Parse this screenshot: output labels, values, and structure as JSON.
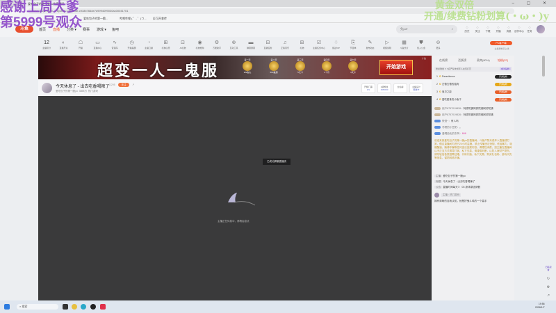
{
  "browser": {
    "tab_title": "爱吃包子的第一脆yu的直播间",
    "url": "www.douyu.com/...?dyshid=1315a0df-c918b766de7d9994099030ac00041701",
    "window_controls": "– ▢ ✕",
    "bookmarks": [
      "爱吃包子的第一脆...",
      "哔哩哔哩 ( ゜- ゜)つ...",
      "反可开拿传"
    ]
  },
  "overlay": {
    "left_line1": "感谢上周大爹",
    "left_line2": "第5999号观众",
    "right_line1": "黄金双倍",
    "right_line2": "开通/续费钻粉划算(・ω・)y"
  },
  "header": {
    "logo": "斗鱼",
    "nav": [
      "首页",
      "直播",
      "分类 ▾",
      "赛事",
      "游戏 ▾",
      "鱼吧"
    ],
    "search_placeholder": "兔yoff",
    "icons": [
      {
        "icon": "history-icon",
        "label": "历史"
      },
      {
        "icon": "heart-icon",
        "label": "关注"
      },
      {
        "icon": "download-icon",
        "label": "下载"
      },
      {
        "icon": "broadcast-icon",
        "label": "开播"
      },
      {
        "icon": "bell-icon",
        "label": "消息"
      },
      {
        "icon": "location-icon",
        "label": "创作中心"
      },
      {
        "icon": "task-icon",
        "label": "任务"
      }
    ]
  },
  "toolbar": {
    "points_value": "12",
    "items": [
      {
        "g": "",
        "l": "主播积分"
      },
      {
        "g": "◐",
        "l": "直播开关"
      },
      {
        "g": "☖",
        "l": "开播"
      },
      {
        "g": "▭",
        "l": "直播中心"
      },
      {
        "g": "∿",
        "l": "音浪码"
      },
      {
        "g": "◷",
        "l": "开播提醒"
      },
      {
        "g": "◔",
        "l": "主播口袋"
      },
      {
        "g": "⊞",
        "l": "礼物心愿"
      },
      {
        "g": "⊡",
        "l": "AI礼物"
      },
      {
        "g": "◉",
        "l": "礼物抢购"
      },
      {
        "g": "⚙",
        "l": "万能助手"
      },
      {
        "g": "⊕",
        "l": "互动工具"
      },
      {
        "g": "▬",
        "l": "弹幕屏幕"
      },
      {
        "g": "⊟",
        "l": "直播任务"
      },
      {
        "g": "♫",
        "l": "正版音乐"
      },
      {
        "g": "⊞",
        "l": "礼物"
      },
      {
        "g": "☑",
        "l": "主播任务中心"
      },
      {
        "g": "♢",
        "l": "挑战VIP"
      },
      {
        "g": "⎘",
        "l": "节目单"
      },
      {
        "g": "✎",
        "l": "发布动态"
      },
      {
        "g": "▷",
        "l": "视频剪辑"
      },
      {
        "g": "▦",
        "l": "斗鱼长片"
      },
      {
        "g": "⛊",
        "l": "加入公会"
      },
      {
        "g": "⊖",
        "l": "更多"
      }
    ],
    "pc_client": "PC客户端",
    "pc_sub": "主播录制已上线"
  },
  "banner": {
    "title": "超变一人一鬼服",
    "prizes": [
      {
        "day": "第一天",
        "label": "2W鱼丸"
      },
      {
        "day": "第二天",
        "label": "500鱼翅"
      },
      {
        "day": "第三天",
        "label": "5元卡"
      },
      {
        "day": "第四天",
        "label": "1个月"
      },
      {
        "day": "第七天",
        "label": "3天卡"
      }
    ],
    "start": "开始游戏",
    "ad": "广告"
  },
  "stream": {
    "title": "今天休息了 - 出去吃香喝辣了",
    "room_id": "41295",
    "follow": "关注",
    "share": "↗",
    "streamer": "爱吃包子的第一脆yu",
    "heat": "3858万",
    "category": "热门游戏",
    "boxes": [
      {
        "top": "开箱门票",
        "val": "0/1"
      },
      {
        "top": "1级粉丝",
        "val": "155/200"
      },
      {
        "top": "全站榜",
        "val": ""
      },
      {
        "top": "主播设计",
        "val": "赠送卡"
      }
    ]
  },
  "video": {
    "toast": "已成功屏蔽直播流",
    "status": "主播正在休息中，请稍后尝试"
  },
  "chat": {
    "tabs": [
      "在线榜",
      "活跃榜",
      "贵宾(80%)",
      "钻粉(57)"
    ],
    "fan_bar": "粉丝徽章 5",
    "fan_hint": "5名严禁未成年人充值打赏",
    "fan_btn": "成为钻粉",
    "ranking": [
      {
        "n": "1",
        "name": "Parasitemor",
        "badge": "开通钻粉",
        "c": "#222"
      },
      {
        "n": "2",
        "name": "古德古德的铭狗",
        "badge": "开通钻粉",
        "c": "#e6a81a"
      },
      {
        "n": "3",
        "name": "宝贝之影",
        "badge": "开通钻粉",
        "c": "#e8602a"
      },
      {
        "n": "4",
        "name": "爱吃甜食的小鱼干",
        "badge": "开通钻粉",
        "c": "#e8602a"
      }
    ],
    "messages": [
      {
        "u": "用户8757019826：",
        "t": "阿弥陀佛阿弥陀佛阿弥陀佛"
      },
      {
        "u": "用户8757019826：",
        "t": "阿弥陀佛阿弥陀佛阿弥陀佛"
      },
      {
        "u": "快语~：",
        "t": "有人吗"
      },
      {
        "u": "冬眠的小豆奶：",
        "t": "。"
      },
      {
        "u": "爱喝西北的东风：",
        "t": "666"
      }
    ],
    "notice": "欢迎来到爱吃包子的第一脆yu的直播间。斗鱼严禁未成年人直播或打赏，倡议直播间内进行24小时监管。禁止传播违法违规、低俗暴力、吸烟酗酒、赌博诈骗等任何违法违规内容。请理性消费，如主播在直播间以不正当方式诱导打赏、私下交易，请谨慎判断，以防人身财产损失。请勿轻信各类招聘征婚、代练代抽、私下交易、购买礼包码、游戏代充等信息，谨防网络诈骗。",
    "info": [
      {
        "k": "主播",
        "v": "爱吃包子的第一脆yu"
      },
      {
        "k": "标题",
        "v": "今天休息了 - 出去吃香喝辣了"
      },
      {
        "k": "公告",
        "v": "直播时间每天7：00-身体原因请假"
      }
    ],
    "last_user": "主播 · 热门游戏",
    "last_msg": "拥有清晰的自我认知，就是拼鬼斗鸡的一个高手"
  },
  "side_tools": [
    "扫码观看",
    "↻",
    "⚙",
    "↗"
  ],
  "taskbar": {
    "search": "搜索",
    "time": "19:56",
    "date": "2026/1/7"
  }
}
